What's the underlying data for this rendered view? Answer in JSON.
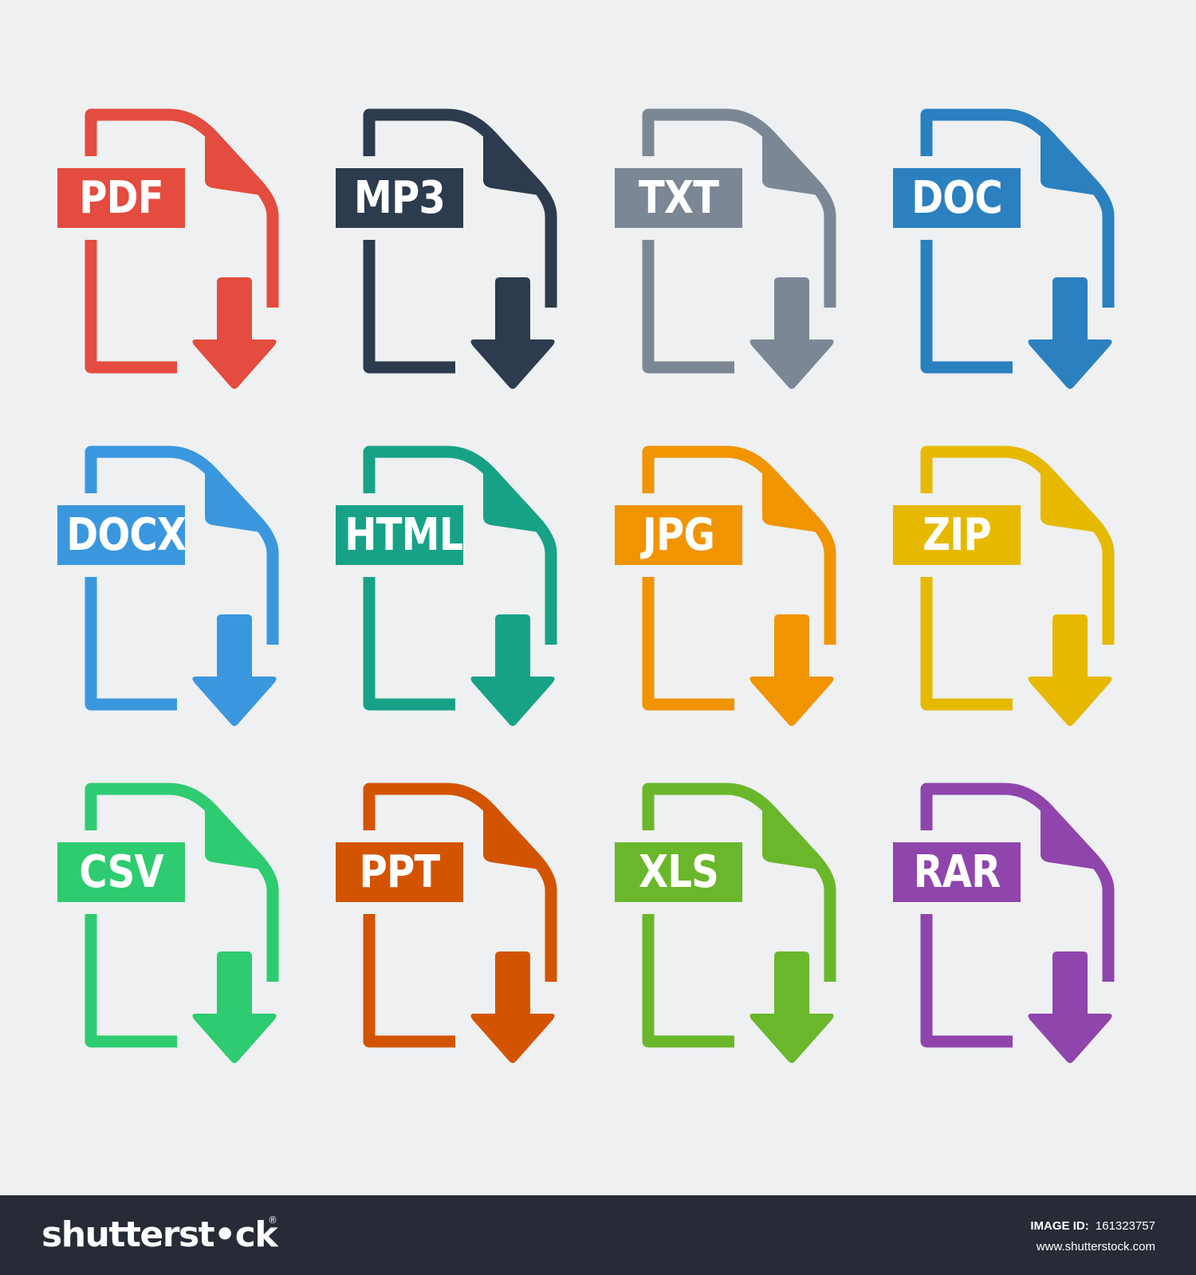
{
  "background": "#eef0f1",
  "icons": [
    {
      "label": "PDF",
      "color": "#e34c3e",
      "icon": "file-download-icon"
    },
    {
      "label": "MP3",
      "color": "#2c3b4d",
      "icon": "file-download-icon"
    },
    {
      "label": "TXT",
      "color": "#7c8796",
      "icon": "file-download-icon"
    },
    {
      "label": "DOC",
      "color": "#2b80c0",
      "icon": "file-download-icon"
    },
    {
      "label": "DOCX",
      "color": "#3a97de",
      "icon": "file-download-icon"
    },
    {
      "label": "HTML",
      "color": "#17a287",
      "icon": "file-download-icon"
    },
    {
      "label": "JPG",
      "color": "#f09400",
      "icon": "file-download-icon"
    },
    {
      "label": "ZIP",
      "color": "#e6b900",
      "icon": "file-download-icon"
    },
    {
      "label": "CSV",
      "color": "#2ecb70",
      "icon": "file-download-icon"
    },
    {
      "label": "PPT",
      "color": "#d35400",
      "icon": "file-download-icon"
    },
    {
      "label": "XLS",
      "color": "#6ab72b",
      "icon": "file-download-icon"
    },
    {
      "label": "RAR",
      "color": "#8f45ac",
      "icon": "file-download-icon"
    }
  ],
  "footer": {
    "background": "#262b36",
    "brand": "shutterst•ck",
    "registered_mark": "®",
    "image_id_label": "IMAGE ID:",
    "image_id": "161323757",
    "site_url": "www.shutterstock.com"
  }
}
